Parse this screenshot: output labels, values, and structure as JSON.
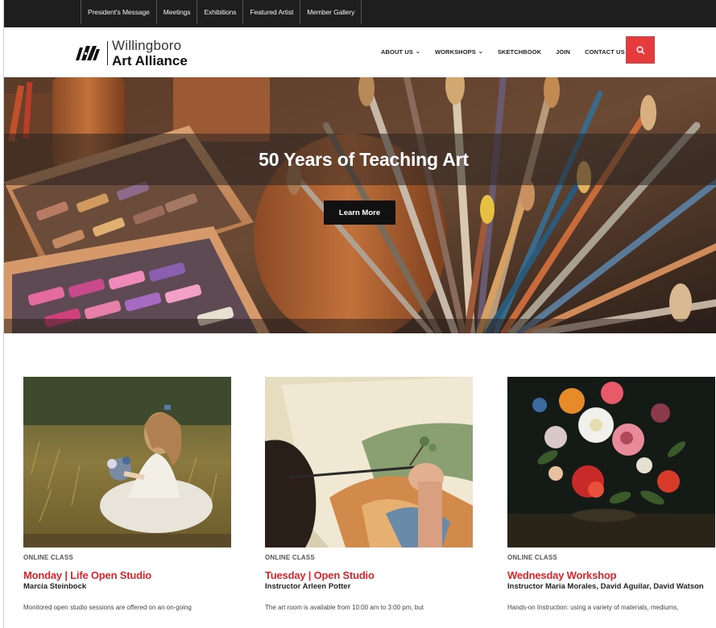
{
  "utility_nav": {
    "items": [
      "President's Message",
      "Meetings",
      "Exhibitions",
      "Featured Artist",
      "Member Gallery"
    ]
  },
  "header": {
    "logo_line1": "Willingboro",
    "logo_line2": "Art Alliance"
  },
  "main_nav": {
    "items": [
      {
        "label": "ABOUT US",
        "has_dropdown": true
      },
      {
        "label": "WORKSHOPS",
        "has_dropdown": true
      },
      {
        "label": "SKETCHBOOK",
        "has_dropdown": false
      },
      {
        "label": "JOIN",
        "has_dropdown": false
      },
      {
        "label": "CONTACT US",
        "has_dropdown": false
      }
    ],
    "search_icon": "search-icon"
  },
  "hero": {
    "title": "50 Years of Teaching Art",
    "button_label": "Learn More"
  },
  "cards": [
    {
      "category": "ONLINE CLASS",
      "title": "Monday | Life Open Studio",
      "subtitle": "Marcia Steinbock",
      "body": "Monitored open studio sessions are offered on an on-going"
    },
    {
      "category": "ONLINE CLASS",
      "title": "Tuesday | Open Studio",
      "subtitle": "Instructor Arleen Potter",
      "body": "The art room is available from 10:00 am to 3:00 pm, but"
    },
    {
      "category": "ONLINE CLASS",
      "title": "Wednesday Workshop",
      "subtitle": "Instructor Maria Morales, David Aguilar, David Watson",
      "body": "Hands-on Instruction: using a variety of materials, mediums,"
    }
  ],
  "colors": {
    "accent": "#d8262c",
    "search_button": "#e63b3d",
    "utility_bar": "#1e1e1e"
  }
}
